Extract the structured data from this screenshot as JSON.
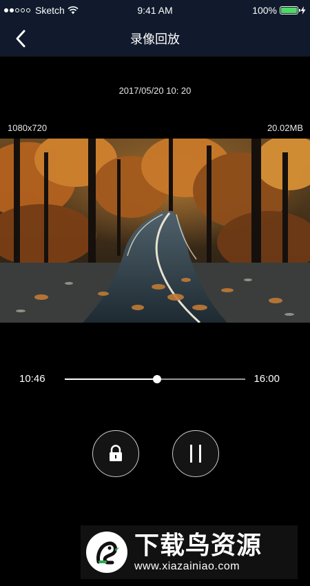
{
  "status_bar": {
    "carrier": "Sketch",
    "time": "9:41 AM",
    "battery": "100%"
  },
  "nav": {
    "back_icon": "chevron-left-icon",
    "title": "录像回放"
  },
  "recording": {
    "datetime": "2017/05/20 10: 20",
    "resolution": "1080x720",
    "file_size": "20.02MB"
  },
  "playback": {
    "start_time": "10:46",
    "end_time": "16:00",
    "progress": 0.51
  },
  "controls": {
    "lock_icon": "lock-icon",
    "pause_icon": "pause-icon"
  },
  "watermark": {
    "title": "下载鸟资源",
    "url": "www.xiazainiao.com"
  },
  "colors": {
    "header_bg": "#101a2c",
    "battery": "#4cd964",
    "background": "#000000"
  }
}
